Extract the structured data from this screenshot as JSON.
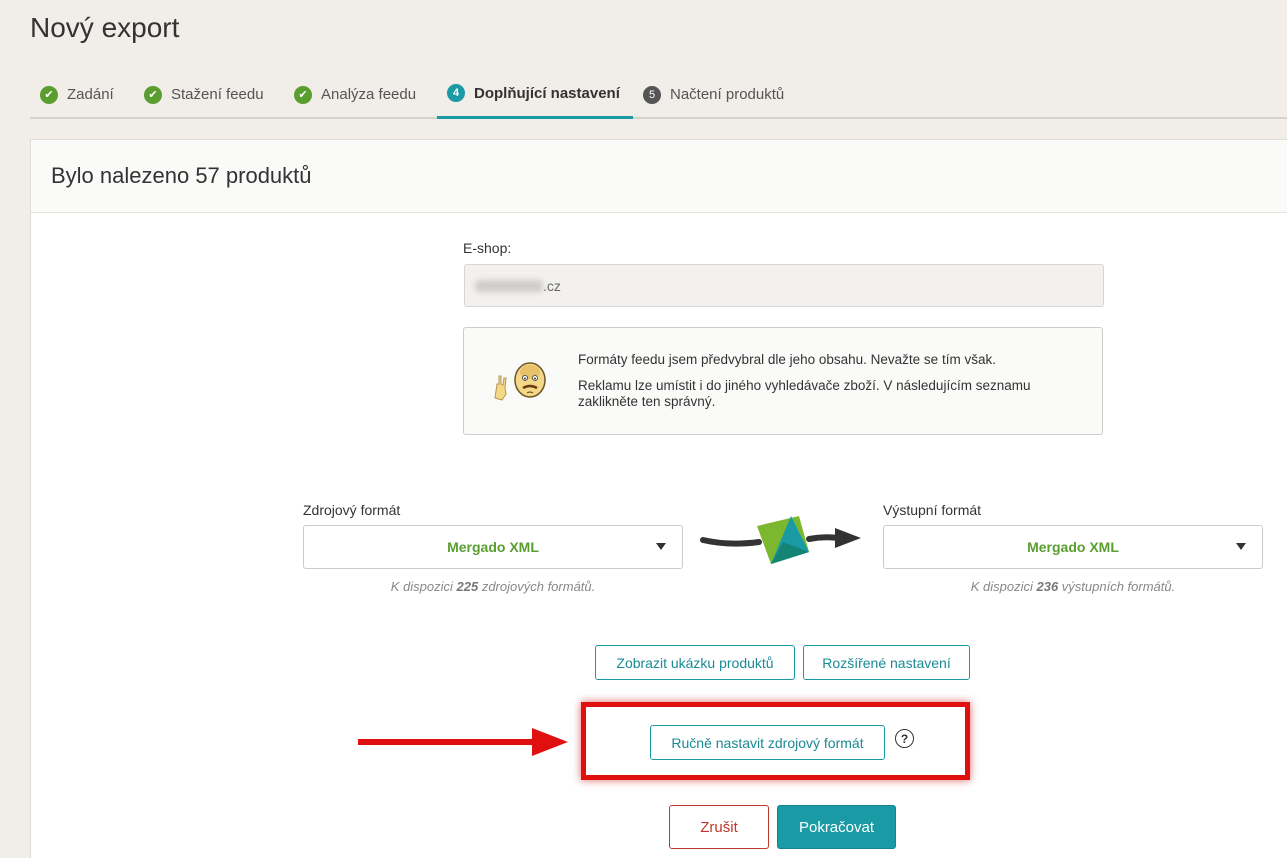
{
  "page": {
    "title": "Nový export"
  },
  "steps": [
    {
      "label": "Zadání",
      "state": "done",
      "num": ""
    },
    {
      "label": "Stažení feedu",
      "state": "done",
      "num": ""
    },
    {
      "label": "Analýza feedu",
      "state": "done",
      "num": ""
    },
    {
      "label": "Doplňující nastavení",
      "state": "active",
      "num": "4"
    },
    {
      "label": "Načtení produktů",
      "state": "todo",
      "num": "5"
    }
  ],
  "card": {
    "title": "Bylo nalezeno 57 produktů"
  },
  "eshop": {
    "label": "E-shop:",
    "value_suffix": ".cz"
  },
  "info": {
    "line1": "Formáty feedu jsem předvybral dle jeho obsahu. Nevažte se tím však.",
    "line2": "Reklamu lze umístit i do jiného vyhledávače zboží. V následujícím seznamu zaklikněte ten správný."
  },
  "source": {
    "label": "Zdrojový formát",
    "value": "Mergado XML",
    "hint_pre": "K dispozici ",
    "hint_count": "225",
    "hint_post": " zdrojových formátů."
  },
  "output": {
    "label": "Výstupní formát",
    "value": "Mergado XML",
    "hint_pre": "K dispozici ",
    "hint_count": "236",
    "hint_post": " výstupních formátů."
  },
  "buttons": {
    "preview": "Zobrazit ukázku produktů",
    "advanced": "Rozšířené nastavení",
    "manual": "Ručně nastavit zdrojový formát",
    "help": "?",
    "cancel": "Zrušit",
    "continue": "Pokračovat"
  },
  "colors": {
    "accent": "#1a9aa5",
    "done": "#5a9e2f",
    "danger": "#c0392b",
    "highlight": "#e01010"
  }
}
